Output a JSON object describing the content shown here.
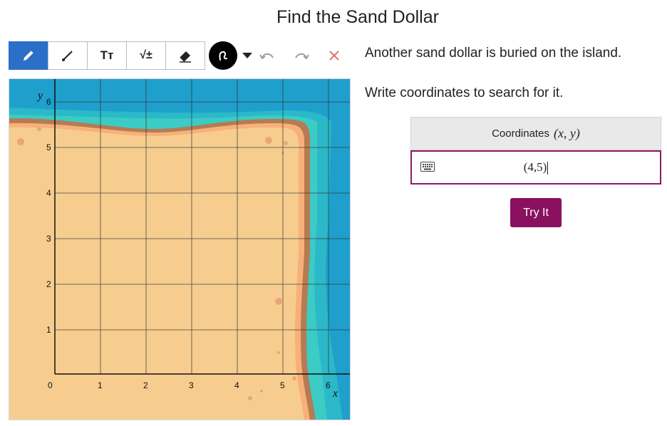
{
  "page": {
    "title": "Find the Sand Dollar"
  },
  "toolbar": {
    "tools": [
      {
        "name": "pencil",
        "icon": "pencil-icon",
        "active": true
      },
      {
        "name": "line",
        "icon": "line-icon",
        "active": false
      },
      {
        "name": "text",
        "icon": "text-icon",
        "label": "Tт",
        "active": false
      },
      {
        "name": "math",
        "icon": "math-icon",
        "label": "√±",
        "active": false
      },
      {
        "name": "eraser",
        "icon": "eraser-icon",
        "active": false
      }
    ],
    "accent": "#2b6fc9",
    "clear_color": "#e5726b"
  },
  "map": {
    "x_axis_label": "x",
    "y_axis_label": "y",
    "x_ticks": [
      "0",
      "1",
      "2",
      "3",
      "4",
      "5",
      "6"
    ],
    "y_ticks": [
      "1",
      "2",
      "3",
      "4",
      "5",
      "6"
    ],
    "colors": {
      "sea": "#29a8cf",
      "shallow": "#3ec6c8",
      "sand": "#f6cd8f",
      "shore": "#b67b52"
    }
  },
  "prompt": {
    "line1": "Another sand dollar is buried on the island.",
    "line2": "Write coordinates to search for it."
  },
  "coordinates": {
    "header": "Coordinates",
    "header_math": "(x, y)",
    "value": "(4,5)"
  },
  "button": {
    "label": "Try It",
    "color": "#8a1060"
  }
}
